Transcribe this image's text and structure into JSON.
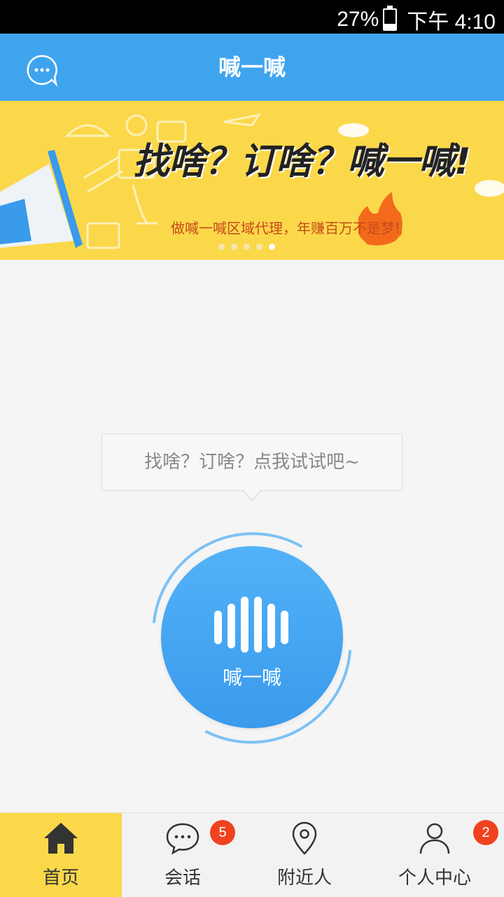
{
  "status_bar": {
    "battery": "27%",
    "time": "下午 4:10"
  },
  "header": {
    "title": "喊一喊"
  },
  "banner": {
    "headline": "找啥？订啥？喊一喊!",
    "subline": "做喊一喊区域代理，年赚百万不是梦!",
    "slide_count": 5,
    "active_slide": 5
  },
  "hint": {
    "text": "找啥？订啥？点我试试吧~"
  },
  "shout_button": {
    "label": "喊一喊"
  },
  "tabs": [
    {
      "label": "首页",
      "icon": "home-icon",
      "active": true
    },
    {
      "label": "会话",
      "icon": "chat-icon",
      "badge": "5"
    },
    {
      "label": "附近人",
      "icon": "location-pin-icon"
    },
    {
      "label": "个人中心",
      "icon": "person-icon",
      "badge": "2"
    }
  ],
  "colors": {
    "primary": "#3fa4ee",
    "accent_yellow": "#fbd84a",
    "badge_red": "#f0421f"
  }
}
